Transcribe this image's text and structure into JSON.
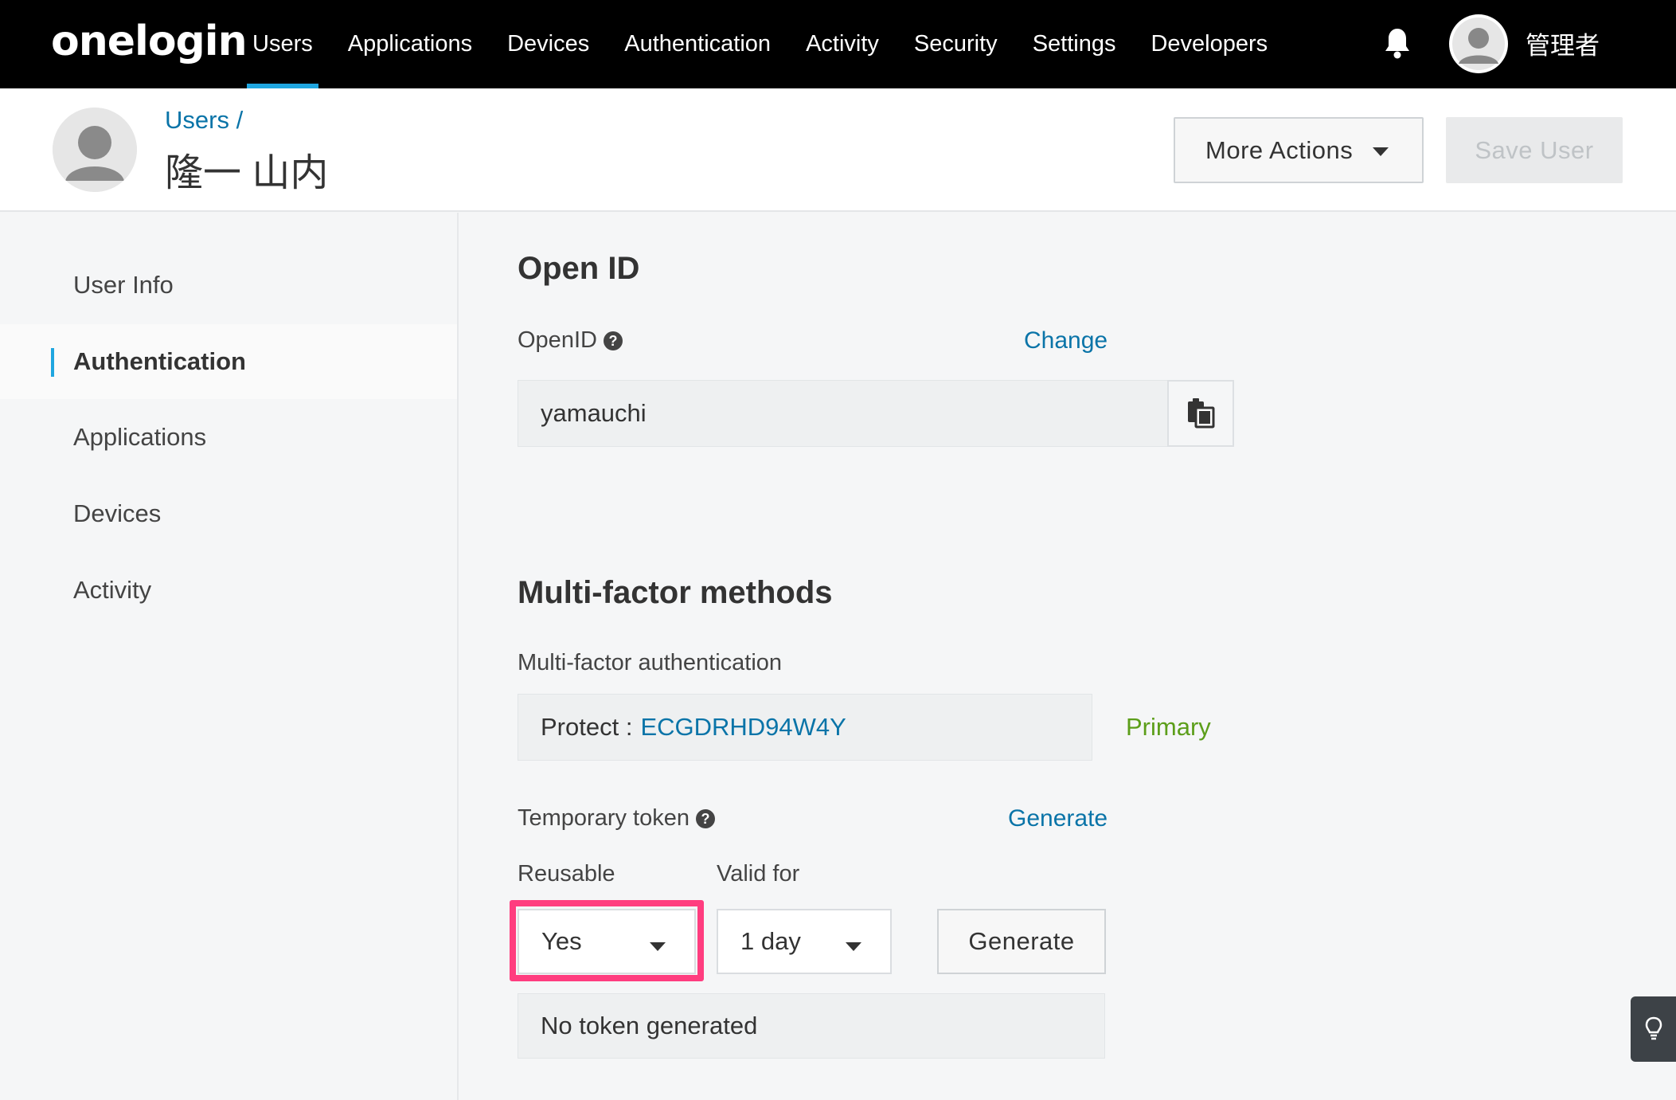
{
  "app": {
    "logo": "onelogin"
  },
  "nav": {
    "items": [
      {
        "label": "Users",
        "active": true
      },
      {
        "label": "Applications"
      },
      {
        "label": "Devices"
      },
      {
        "label": "Authentication"
      },
      {
        "label": "Activity"
      },
      {
        "label": "Security"
      },
      {
        "label": "Settings"
      },
      {
        "label": "Developers"
      }
    ],
    "username": "管理者"
  },
  "header": {
    "breadcrumb": "Users /",
    "user_name": "隆一 山内",
    "more_actions": "More Actions",
    "save_user": "Save User"
  },
  "sidebar": {
    "items": [
      {
        "label": "User Info"
      },
      {
        "label": "Authentication",
        "active": true
      },
      {
        "label": "Applications"
      },
      {
        "label": "Devices"
      },
      {
        "label": "Activity"
      }
    ]
  },
  "openid": {
    "heading": "Open ID",
    "label": "OpenID",
    "change": "Change",
    "value": "yamauchi"
  },
  "mfa": {
    "heading": "Multi-factor methods",
    "label": "Multi-factor authentication",
    "protect_prefix": "Protect :",
    "device_id": "ECGDRHD94W4Y",
    "primary": "Primary"
  },
  "token": {
    "label": "Temporary token",
    "generate_link": "Generate",
    "reusable_label": "Reusable",
    "reusable_value": "Yes",
    "valid_label": "Valid for",
    "valid_value": "1 day",
    "generate_button": "Generate",
    "status": "No token generated"
  },
  "colors": {
    "accent": "#1fa6e0",
    "link": "#0a74a8",
    "primary_green": "#5c9e1a",
    "highlight": "#ff3d7f"
  },
  "icons": {
    "bell": "bell-icon",
    "copy": "copy-icon",
    "help": "help-icon",
    "tips": "lightbulb-icon"
  }
}
